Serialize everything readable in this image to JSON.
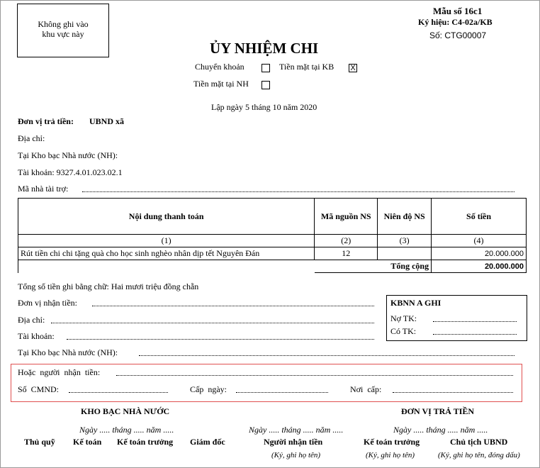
{
  "corner_box": "Không ghi vào khu vực này",
  "form": {
    "mau_so": "Mẫu số 16c1",
    "ky_hieu": "Ký hiệu: C4-02a/KB",
    "so": "Số: CTG00007"
  },
  "title": "ỦY NHIỆM CHI",
  "options": {
    "chuyen_khoan": {
      "label": "Chuyển khoản",
      "mark": ""
    },
    "tien_mat_kb": {
      "label": "Tiền mặt tại KB",
      "mark": "X"
    },
    "tien_mat_nh": {
      "label": "Tiền mặt tại NH",
      "mark": ""
    }
  },
  "date_line": "Lập ngày 5 tháng 10 năm 2020",
  "payer": {
    "don_vi_label": "Đơn vị trả tiền:",
    "don_vi_value": "UBND xã",
    "dia_chi": "Địa chỉ:",
    "kho_bac": "Tại Kho bạc Nhà nước (NH):",
    "tai_khoan": "Tài khoản: 9327.4.01.023.02.1",
    "ma_nha_tai_tro": "Mã nhà tài trợ:"
  },
  "table": {
    "headers": [
      "Nội dung thanh toán",
      "Mã nguồn NS",
      "Niên độ NS",
      "Số tiền"
    ],
    "index_row": [
      "(1)",
      "(2)",
      "(3)",
      "(4)"
    ],
    "rows": [
      {
        "noi_dung": "Rút tiền chi chi tặng quà cho học sinh nghèo nhân dịp tết Nguyên Đán",
        "ma_nguon": "12",
        "nien_do": "",
        "so_tien": "20.000.000"
      }
    ],
    "total_label": "Tổng cộng",
    "total_value": "20.000.000"
  },
  "amount_words": "Tổng số tiền ghi bằng chữ: Hai mươi triệu đồng chẵn",
  "payee": {
    "don_vi": "Đơn vị nhận tiền:",
    "dia_chi": "Địa chỉ:",
    "tai_khoan": "Tài khoản:",
    "kho_bac": "Tại Kho bạc Nhà nước (NH):"
  },
  "kbnn": {
    "title": "KBNN A GHI",
    "no_tk": "Nợ TK:",
    "co_tk": "Có TK:"
  },
  "recipient": {
    "nguoi_nhan": "Hoặc người nhận tiền:",
    "so_cmnd": "Số CMND:",
    "cap_ngay": "Cấp ngày:",
    "noi_cap": "Nơi cấp:"
  },
  "signatures": {
    "kho_bac": "KHO BẠC NHÀ NƯỚC",
    "don_vi": "ĐƠN VỊ TRẢ TIỀN",
    "date_placeholder": "Ngày ..... tháng ..... năm .....",
    "roles": {
      "thu_quy": "Thủ quỹ",
      "ke_toan": "Kế toán",
      "ke_toan_truong_kb": "Kế toán trưởng",
      "giam_doc": "Giám đốc",
      "nguoi_nhan": "Người nhận tiền",
      "ke_toan_truong_dv": "Kế toán trưởng",
      "chu_tich": "Chủ tịch UBND"
    },
    "note_name": "(Ký, ghi họ tên)",
    "note_name_stamp": "(Ký, ghi họ tên, đóng dấu)"
  }
}
